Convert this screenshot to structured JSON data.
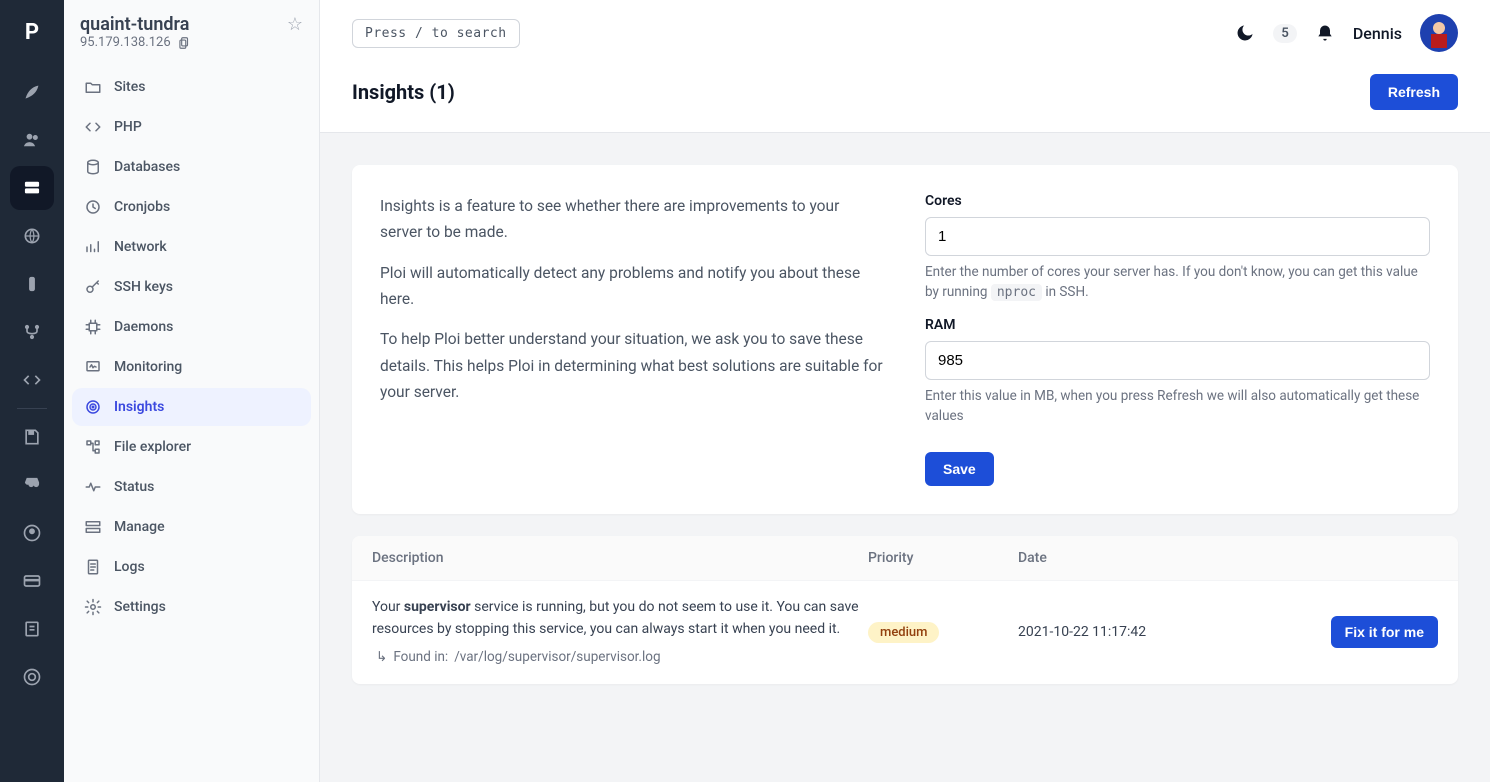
{
  "rail": {
    "logo": "P"
  },
  "server": {
    "name": "quaint-tundra",
    "ip": "95.179.138.126"
  },
  "nav": {
    "items": [
      {
        "label": "Sites"
      },
      {
        "label": "PHP"
      },
      {
        "label": "Databases"
      },
      {
        "label": "Cronjobs"
      },
      {
        "label": "Network"
      },
      {
        "label": "SSH keys"
      },
      {
        "label": "Daemons"
      },
      {
        "label": "Monitoring"
      },
      {
        "label": "Insights"
      },
      {
        "label": "File explorer"
      },
      {
        "label": "Status"
      },
      {
        "label": "Manage"
      },
      {
        "label": "Logs"
      },
      {
        "label": "Settings"
      }
    ]
  },
  "topbar": {
    "search_label": "Press / to search",
    "notification_count": "5",
    "username": "Dennis"
  },
  "page": {
    "title": "Insights (1)",
    "refresh_label": "Refresh"
  },
  "info": {
    "p1": "Insights is a feature to see whether there are improvements to your server to be made.",
    "p2": "Ploi will automatically detect any problems and notify you about these here.",
    "p3": "To help Ploi better understand your situation, we ask you to save these details. This helps Ploi in determining what best solutions are suitable for your server."
  },
  "form": {
    "cores_label": "Cores",
    "cores_value": "1",
    "cores_help_pre": "Enter the number of cores your server has. If you don't know, you can get this value by running ",
    "cores_help_code": "nproc",
    "cores_help_post": " in SSH.",
    "ram_label": "RAM",
    "ram_value": "985",
    "ram_help": "Enter this value in MB, when you press Refresh we will also automatically get these values",
    "save_label": "Save"
  },
  "table": {
    "headers": {
      "description": "Description",
      "priority": "Priority",
      "date": "Date"
    },
    "row": {
      "desc_pre": "Your ",
      "desc_strong": "supervisor",
      "desc_post": " service is running, but you do not seem to use it. You can save resources by stopping this service, you can always start it when you need it.",
      "found_in_prefix": "Found in: ",
      "found_in_path": "/var/log/supervisor/supervisor.log",
      "priority": "medium",
      "date": "2021-10-22 11:17:42",
      "action": "Fix it for me"
    }
  }
}
